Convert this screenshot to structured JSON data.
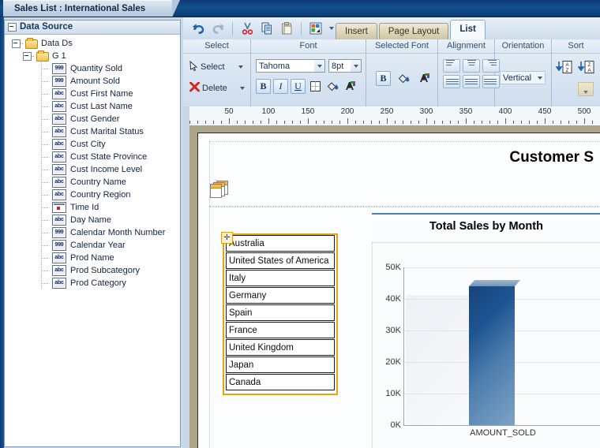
{
  "window": {
    "title": "Sales List : International Sales"
  },
  "sidebar": {
    "header": "Data Source",
    "root": {
      "label": "Data Ds",
      "icon": "folder-icon"
    },
    "group": {
      "label": "G 1",
      "icon": "folder-icon"
    },
    "fields": [
      {
        "label": "Quantity Sold",
        "type": "999"
      },
      {
        "label": "Amount Sold",
        "type": "999"
      },
      {
        "label": "Cust First Name",
        "type": "abc"
      },
      {
        "label": "Cust Last Name",
        "type": "abc"
      },
      {
        "label": "Cust Gender",
        "type": "abc"
      },
      {
        "label": "Cust Marital Status",
        "type": "abc"
      },
      {
        "label": "Cust City",
        "type": "abc"
      },
      {
        "label": "Cust State Province",
        "type": "abc"
      },
      {
        "label": "Cust Income Level",
        "type": "abc"
      },
      {
        "label": "Country Name",
        "type": "abc"
      },
      {
        "label": "Country Region",
        "type": "abc"
      },
      {
        "label": "Time Id",
        "type": "date"
      },
      {
        "label": "Day Name",
        "type": "abc"
      },
      {
        "label": "Calendar Month Number",
        "type": "999"
      },
      {
        "label": "Calendar Year",
        "type": "999"
      },
      {
        "label": "Prod Name",
        "type": "abc"
      },
      {
        "label": "Prod Subcategory",
        "type": "abc"
      },
      {
        "label": "Prod Category",
        "type": "abc"
      }
    ]
  },
  "quick_access": {
    "undo": "undo-icon",
    "redo": "redo-icon",
    "cut": "cut-icon",
    "copy": "copy-icon",
    "paste": "paste-icon",
    "insert_chart": "chart-icon",
    "dropdown": "chevron-down-icon"
  },
  "tabs": [
    {
      "label": "Insert",
      "active": false
    },
    {
      "label": "Page Layout",
      "active": false
    },
    {
      "label": "List",
      "active": true
    }
  ],
  "ribbon": {
    "groups": [
      {
        "name": "Select"
      },
      {
        "name": "Font"
      },
      {
        "name": "Selected Font"
      },
      {
        "name": "Alignment"
      },
      {
        "name": "Orientation"
      },
      {
        "name": "Sort"
      }
    ],
    "select_group": {
      "select_label": "Select",
      "delete_label": "Delete"
    },
    "font_group": {
      "font_family": "Tahoma",
      "font_size": "8pt",
      "bold": "B",
      "italic": "I",
      "underline": "U",
      "border": "border-icon",
      "fill_color": "fill-color-icon",
      "font_color": "font-color-icon"
    },
    "selected_font_group": {
      "bold": "B",
      "fill_color": "fill-color-icon",
      "font_color": "font-color-icon"
    },
    "alignment_group": {
      "buttons": [
        "align-top-left",
        "align-top-center",
        "align-top-right",
        "align-left",
        "align-center",
        "align-right"
      ]
    },
    "orientation_group": {
      "value": "Vertical"
    },
    "sort_group": {
      "sort_asc": "sort-az-icon",
      "sort_desc": "sort-za-icon",
      "more": "sort-more-icon"
    }
  },
  "ruler": {
    "labels": [
      50,
      100,
      150,
      200,
      250,
      300,
      350,
      400,
      450,
      500
    ]
  },
  "report": {
    "title": "Customer S",
    "pages_icon": "pages-icon",
    "list": {
      "items": [
        "Australia",
        "United States of America",
        "Italy",
        "Germany",
        "Spain",
        "France",
        "United Kingdom",
        "Japan",
        "Canada"
      ]
    }
  },
  "chart_data": {
    "type": "bar",
    "title": "Total Sales by Month",
    "categories": [
      "AMOUNT_SOLD"
    ],
    "values": [
      44000
    ],
    "xlabel": "AMOUNT_SOLD",
    "ylabel": "",
    "ylim": [
      0,
      50000
    ],
    "yticks": [
      0,
      10000,
      20000,
      30000,
      40000,
      50000
    ],
    "ytick_labels": [
      "0K",
      "10K",
      "20K",
      "30K",
      "40K",
      "50K"
    ],
    "grid": true,
    "legend": "none",
    "bar_color": "#1b4d85"
  }
}
